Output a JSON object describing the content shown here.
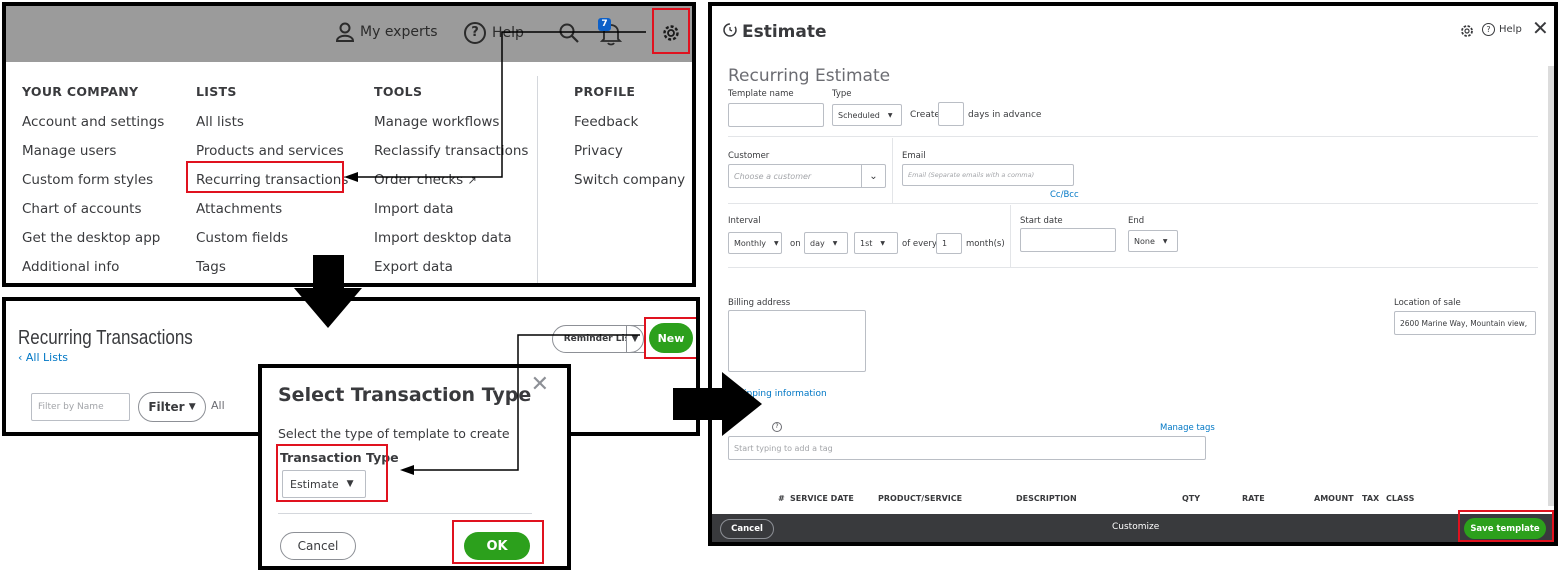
{
  "menu": {
    "topbar": {
      "experts_label": "My experts",
      "help_label": "Help",
      "badge": "7"
    },
    "columns": [
      {
        "heading": "YOUR COMPANY",
        "items": [
          "Account and settings",
          "Manage users",
          "Custom form styles",
          "Chart of accounts",
          "Get the desktop app",
          "Additional info"
        ]
      },
      {
        "heading": "LISTS",
        "items": [
          "All lists",
          "Products and services",
          "Recurring transactions",
          "Attachments",
          "Custom fields",
          "Tags"
        ]
      },
      {
        "heading": "TOOLS",
        "items": [
          "Manage workflows",
          "Reclassify transactions",
          "Order checks",
          "Import data",
          "Import desktop data",
          "Export data"
        ]
      },
      {
        "heading": "PROFILE",
        "items": [
          "Feedback",
          "Privacy",
          "Switch company"
        ]
      }
    ]
  },
  "recurring": {
    "title": "Recurring Transactions",
    "back_link": "All Lists",
    "filter_placeholder": "Filter by Name",
    "filter_button": "Filter",
    "filter_value": "All",
    "reminder_button": "Reminder List",
    "new_button": "New"
  },
  "dialog": {
    "title": "Select Transaction Type",
    "hint": "Select the type of template to create",
    "type_label": "Transaction Type",
    "type_value": "Estimate",
    "cancel": "Cancel",
    "ok": "OK"
  },
  "estimate": {
    "header_title": "Estimate",
    "help_label": "Help",
    "subtitle": "Recurring Estimate",
    "template_name_label": "Template name",
    "type_label": "Type",
    "type_value": "Scheduled",
    "create_label": "Create",
    "days_advance": "days in advance",
    "customer_label": "Customer",
    "customer_placeholder": "Choose a customer",
    "email_label": "Email",
    "email_placeholder": "Email (Separate emails with a comma)",
    "ccbcc": "Cc/Bcc",
    "interval_label": "Interval",
    "interval_value": "Monthly",
    "on_label": "on",
    "day_value": "day",
    "nth_value": "1st",
    "of_every": "of every",
    "every_value": "1",
    "months_label": "month(s)",
    "start_date_label": "Start date",
    "end_label": "End",
    "end_value": "None",
    "billing_label": "Billing address",
    "location_label": "Location of sale",
    "location_value": "2600 Marine Way, Mountain view,",
    "shipping_link": "ipping information",
    "manage_tags": "Manage tags",
    "tags_placeholder": "Start typing to add a tag",
    "table_headers": [
      "#",
      "SERVICE DATE",
      "PRODUCT/SERVICE",
      "DESCRIPTION",
      "QTY",
      "RATE",
      "AMOUNT",
      "TAX",
      "CLASS"
    ],
    "footer_cancel": "Cancel",
    "footer_customize": "Customize",
    "footer_save": "Save template"
  },
  "colors": {
    "brand_green": "#2ca01c",
    "highlight_red": "#e0121f",
    "link_blue": "#0077c5",
    "footer_dark": "#393a3d"
  }
}
